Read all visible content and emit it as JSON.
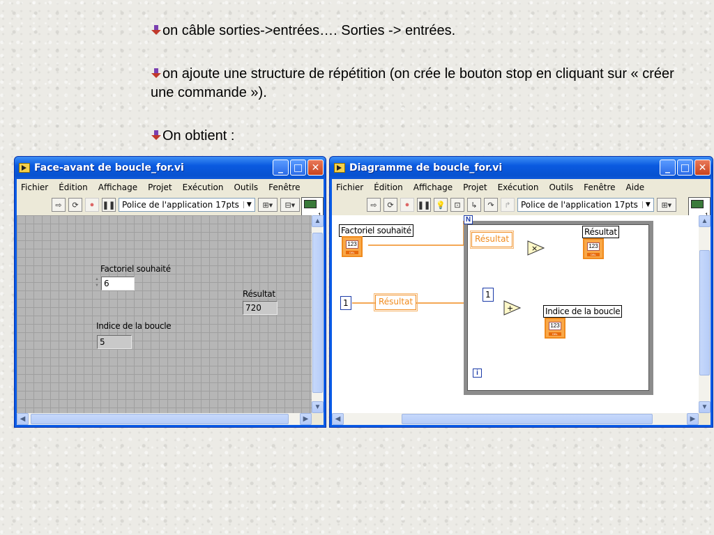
{
  "slide": {
    "line1": "on câble sorties->entrées…. Sorties -> entrées.",
    "line2": "on ajoute une structure de répétition (on crée le bouton stop en cliquant sur « créer une commande »).",
    "line3": "On obtient :"
  },
  "front_panel": {
    "title": "Face-avant de boucle_for.vi",
    "menu": [
      "Fichier",
      "Édition",
      "Affichage",
      "Projet",
      "Exécution",
      "Outils",
      "Fenêtre"
    ],
    "font_select": "Police de l'application 17pts",
    "controls": {
      "factoriel_label": "Factoriel souhaité",
      "factoriel_value": "6",
      "resultat_label": "Résultat",
      "resultat_value": "720",
      "indice_label": "Indice de la boucle",
      "indice_value": "5"
    }
  },
  "block_diagram": {
    "title": "Diagramme de boucle_for.vi",
    "menu": [
      "Fichier",
      "Édition",
      "Affichage",
      "Projet",
      "Exécution",
      "Outils",
      "Fenêtre",
      "Aide"
    ],
    "font_select": "Police de l'application 17pts",
    "labels": {
      "factoriel": "Factoriel souhaité",
      "resultat_shift_left": "Résultat",
      "resultat_shift_in": "Résultat",
      "resultat_out": "Résultat",
      "indice": "Indice de la boucle",
      "const_one_outer": "1",
      "const_one_inner": "1",
      "loop_count": "N",
      "loop_index": "i",
      "terminal_text": "123",
      "terminal_type": "DBL",
      "multiply": "×",
      "add": "+"
    }
  },
  "colors": {
    "titlebar": "#0a5be6",
    "panel_grid": "#b6b6b6",
    "wire_orange": "#f08a1c",
    "wire_blue": "#1a3aa8"
  }
}
